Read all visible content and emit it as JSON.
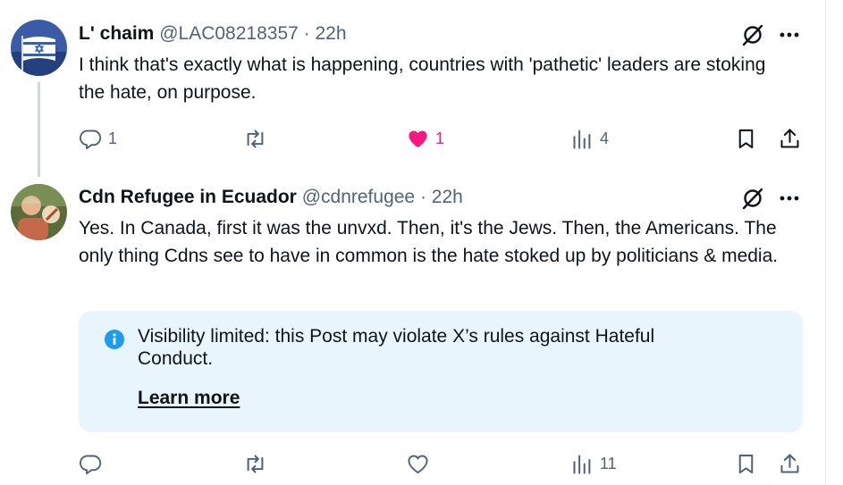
{
  "posts": [
    {
      "display_name": "L' chaim",
      "handle": "@LAC08218357",
      "separator": "·",
      "time": "22h",
      "text": "I think that's exactly what is happening, countries with 'pathetic' leaders are stoking the hate, on purpose.",
      "replies": "1",
      "reposts": "",
      "likes": "1",
      "liked": true,
      "views": "4"
    },
    {
      "display_name": "Cdn Refugee in Ecuador",
      "handle": "@cdnrefugee",
      "separator": "·",
      "time": "22h",
      "text": "Yes. In Canada, first it was the unvxd. Then, it's the Jews. Then, the Americans. The only thing Cdns see to have in common is the hate stoked up by politicians & media.",
      "replies": "",
      "reposts": "",
      "likes": "",
      "liked": false,
      "views": "11",
      "notice": {
        "text": "Visibility limited: this Post may violate X’s rules against Hateful Conduct.",
        "link": "Learn more"
      }
    }
  ],
  "colors": {
    "text": "#0f1419",
    "muted": "#536471",
    "like_active": "#f91880",
    "notice_bg": "#e8f5fd",
    "info_icon": "#1d9bf0",
    "thread_line": "#cfd9de"
  },
  "icons": [
    "grok-icon",
    "more-icon",
    "reply-icon",
    "repost-icon",
    "heart-icon",
    "views-icon",
    "bookmark-icon",
    "share-icon",
    "info-icon"
  ]
}
